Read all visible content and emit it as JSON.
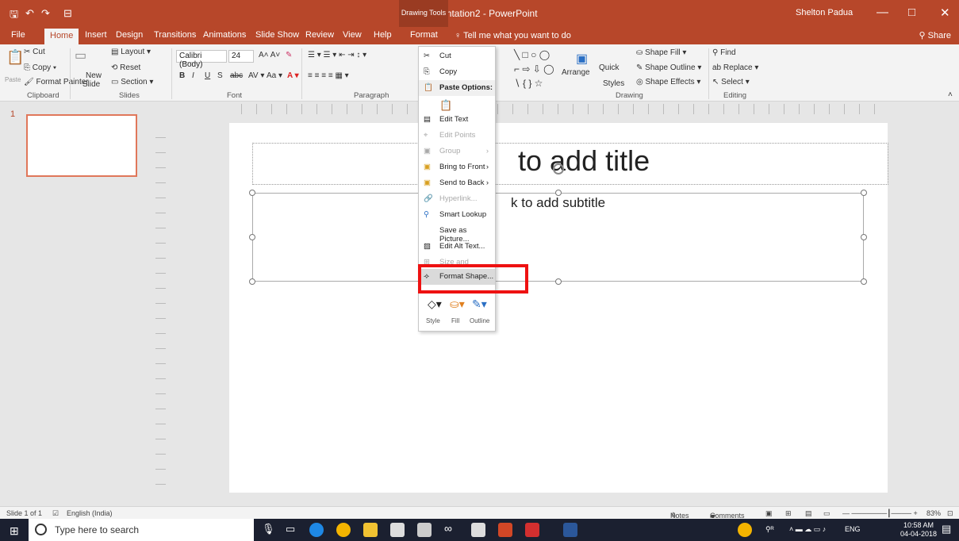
{
  "titlebar": {
    "title": "Presentation2 - PowerPoint",
    "drawing_tools": "Drawing Tools",
    "user": "Shelton Padua",
    "save_icon": "save-icon",
    "undo_icon": "undo-icon",
    "redo_icon": "redo-icon",
    "min": "—",
    "max": "□",
    "close": "✕"
  },
  "tabs": {
    "file": "File",
    "home": "Home",
    "insert": "Insert",
    "design": "Design",
    "transitions": "Transitions",
    "animations": "Animations",
    "slideshow": "Slide Show",
    "review": "Review",
    "view": "View",
    "help": "Help",
    "format": "Format",
    "tellme": "Tell me what you want to do",
    "share": "Share"
  },
  "ribbon": {
    "clipboard": {
      "cut": "Cut",
      "copy": "Copy",
      "paste": "Paste",
      "format_painter": "Format Painter",
      "group": "Clipboard"
    },
    "slides": {
      "layout": "Layout",
      "reset": "Reset",
      "new_slide_1": "New",
      "new_slide_2": "Slide",
      "section": "Section",
      "group": "Slides"
    },
    "font": {
      "family": "Calibri (Body)",
      "size": "24",
      "group": "Font"
    },
    "paragraph": {
      "group": "Paragraph"
    },
    "drawing": {
      "arrange": "Arrange",
      "quick_styles_1": "Quick",
      "quick_styles_2": "Styles",
      "shape_fill": "Shape Fill",
      "shape_outline": "Shape Outline",
      "shape_effects": "Shape Effects",
      "group": "Drawing"
    },
    "editing": {
      "find": "Find",
      "replace": "Replace",
      "select": "Select",
      "group": "Editing"
    }
  },
  "context_menu": {
    "cut": "Cut",
    "copy": "Copy",
    "paste_options": "Paste Options:",
    "edit_text": "Edit Text",
    "edit_points": "Edit Points",
    "group": "Group",
    "bring_to_front": "Bring to Front",
    "send_to_back": "Send to Back",
    "hyperlink": "Hyperlink...",
    "smart_lookup": "Smart Lookup",
    "save_as_picture": "Save as Picture...",
    "edit_alt_text": "Edit Alt Text...",
    "size_position": "Size and Position...",
    "format_shape": "Format Shape..."
  },
  "minibar": {
    "style": "Style",
    "fill": "Fill",
    "outline": "Outline"
  },
  "thumbnails": {
    "slide_number": "1"
  },
  "slide": {
    "title": "to add title",
    "subtitle": "k to add subtitle"
  },
  "statusbar": {
    "slide_count": "Slide 1 of 1",
    "language": "English (India)",
    "notes": "Notes",
    "comments": "Comments",
    "zoom": "83%"
  },
  "taskbar": {
    "search_placeholder": "Type here to search",
    "lang": "ENG",
    "time": "10:58 AM",
    "date": "04-04-2018"
  },
  "colors": {
    "accent": "#b7472a",
    "highlight": "#e11111"
  }
}
